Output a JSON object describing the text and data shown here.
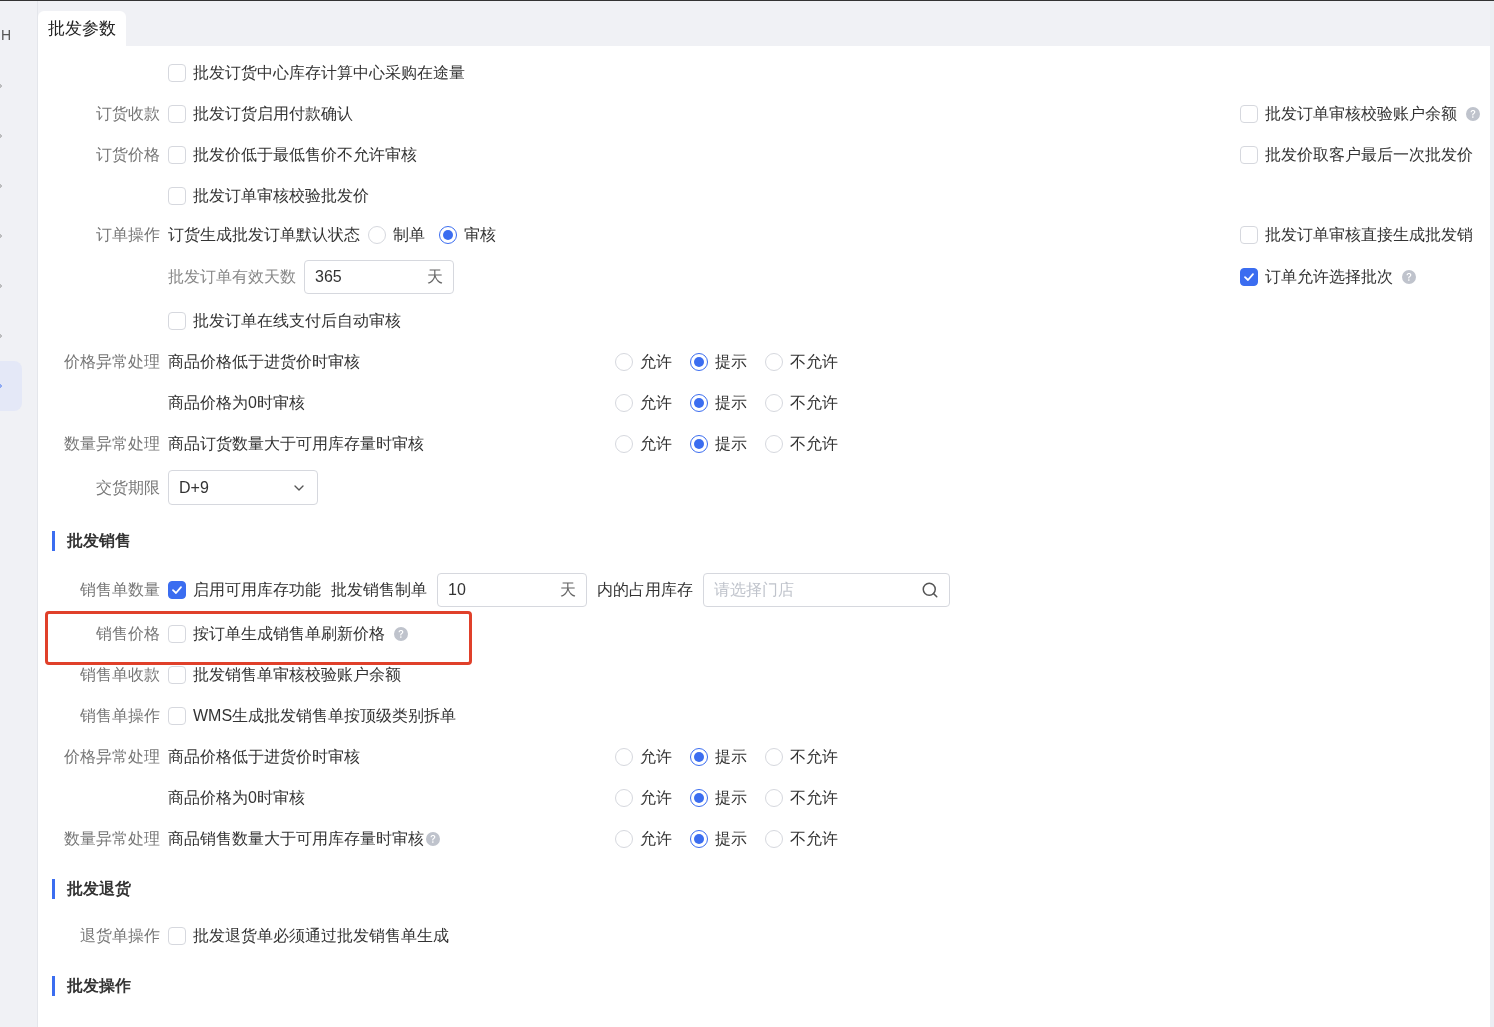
{
  "sidebar": {
    "heading": "H",
    "items": [
      {
        "selected": false
      },
      {
        "selected": false
      },
      {
        "selected": false
      },
      {
        "selected": false
      },
      {
        "selected": false
      },
      {
        "selected": false
      },
      {
        "selected": true
      }
    ]
  },
  "tab": {
    "label": "批发参数",
    "selected": true
  },
  "sections": [
    {
      "rows": [
        {
          "kind": "checkbox",
          "checked": false,
          "text": "批发订货中心库存计算中心采购在途量",
          "help": false
        },
        {
          "label": "订货收款",
          "kind": "checkbox",
          "checked": false,
          "text": "批发订货启用付款确认",
          "help": false,
          "right": {
            "checked": false,
            "text": "批发订单审核校验账户余额",
            "help": true
          }
        },
        {
          "label": "订货价格",
          "kind": "checkbox",
          "checked": false,
          "text": "批发价低于最低售价不允许审核",
          "help": false,
          "right": {
            "checked": false,
            "text": "批发价取客户最后一次批发价",
            "help": false
          }
        },
        {
          "kind": "checkbox",
          "checked": false,
          "text": "批发订单审核校验批发价",
          "help": false
        },
        {
          "label": "订单操作",
          "kind": "radio-inline",
          "text": "订货生成批发订单默认状态",
          "options": [
            {
              "label": "制单",
              "selected": false
            },
            {
              "label": "审核",
              "selected": true
            }
          ],
          "right": {
            "checked": false,
            "text": "批发订单审核直接生成批发销",
            "help": false
          }
        },
        {
          "kind": "days",
          "text": "批发订单有效天数",
          "value": "365",
          "unit": "天",
          "right": {
            "checked": true,
            "text": "订单允许选择批次",
            "help": true
          }
        },
        {
          "kind": "checkbox",
          "checked": false,
          "text": "批发订单在线支付后自动审核",
          "help": false
        },
        {
          "label": "价格异常处理",
          "kind": "radio-row",
          "text": "商品价格低于进货价时审核",
          "help": false,
          "options": [
            {
              "label": "允许",
              "selected": false
            },
            {
              "label": "提示",
              "selected": true
            },
            {
              "label": "不允许",
              "selected": false
            }
          ]
        },
        {
          "kind": "radio-row",
          "text": "商品价格为0时审核",
          "help": false,
          "options": [
            {
              "label": "允许",
              "selected": false
            },
            {
              "label": "提示",
              "selected": true
            },
            {
              "label": "不允许",
              "selected": false
            }
          ]
        },
        {
          "label": "数量异常处理",
          "kind": "radio-row",
          "text": "商品订货数量大于可用库存量时审核",
          "help": false,
          "options": [
            {
              "label": "允许",
              "selected": false
            },
            {
              "label": "提示",
              "selected": true
            },
            {
              "label": "不允许",
              "selected": false
            }
          ]
        },
        {
          "label": "交货期限",
          "kind": "select",
          "value": "D+9"
        }
      ]
    },
    {
      "heading": "批发销售",
      "rows": [
        {
          "label": "销售单数量",
          "kind": "stock",
          "checked": true,
          "text": "启用可用库存功能",
          "text2": "批发销售制单",
          "value": "10",
          "unit": "天",
          "text3": "内的占用库存",
          "placeholder": "请选择门店"
        },
        {
          "label": "销售价格",
          "kind": "checkbox",
          "checked": false,
          "text": "按订单生成销售单刷新价格",
          "help": true,
          "highlighted": true
        },
        {
          "label": "销售单收款",
          "kind": "checkbox",
          "checked": false,
          "text": "批发销售单审核校验账户余额",
          "help": false
        },
        {
          "label": "销售单操作",
          "kind": "checkbox",
          "checked": false,
          "text": "WMS生成批发销售单按顶级类别拆单",
          "help": false
        },
        {
          "label": "价格异常处理",
          "kind": "radio-row",
          "text": "商品价格低于进货价时审核",
          "help": false,
          "options": [
            {
              "label": "允许",
              "selected": false
            },
            {
              "label": "提示",
              "selected": true
            },
            {
              "label": "不允许",
              "selected": false
            }
          ]
        },
        {
          "kind": "radio-row",
          "text": "商品价格为0时审核",
          "help": false,
          "options": [
            {
              "label": "允许",
              "selected": false
            },
            {
              "label": "提示",
              "selected": true
            },
            {
              "label": "不允许",
              "selected": false
            }
          ]
        },
        {
          "label": "数量异常处理",
          "kind": "radio-row",
          "text": "商品销售数量大于可用库存量时审核",
          "help": true,
          "options": [
            {
              "label": "允许",
              "selected": false
            },
            {
              "label": "提示",
              "selected": true
            },
            {
              "label": "不允许",
              "selected": false
            }
          ]
        }
      ]
    },
    {
      "heading": "批发退货",
      "rows": [
        {
          "label": "退货单操作",
          "kind": "checkbox",
          "checked": false,
          "text": "批发退货单必须通过批发销售单生成",
          "help": false
        }
      ]
    },
    {
      "heading": "批发操作"
    }
  ]
}
